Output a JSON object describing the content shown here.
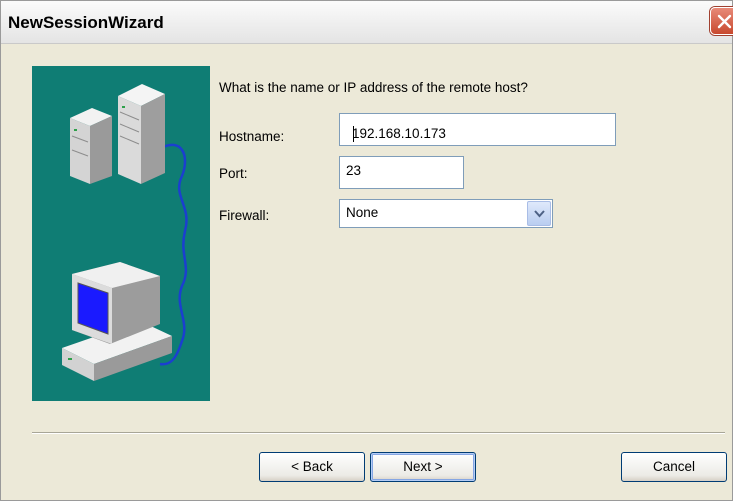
{
  "window": {
    "title": "NewSessionWizard"
  },
  "question": "What is the name or IP address of the remote host?",
  "form": {
    "hostname_label": "Hostname:",
    "hostname_value": "192.168.10.173",
    "port_label": "Port:",
    "port_value": "23",
    "firewall_label": "Firewall:",
    "firewall_value": "None"
  },
  "buttons": {
    "back": "< Back",
    "next": "Next >",
    "cancel": "Cancel"
  },
  "colors": {
    "illustration_background": "#0f7d74",
    "close_button": "#c8492f",
    "monitor_screen": "#1a1aff",
    "cable": "#1b3fd0"
  },
  "icons": [
    "close-icon",
    "server-towers-icon",
    "desktop-computer-icon",
    "network-cable-icon",
    "chevron-down-icon"
  ]
}
